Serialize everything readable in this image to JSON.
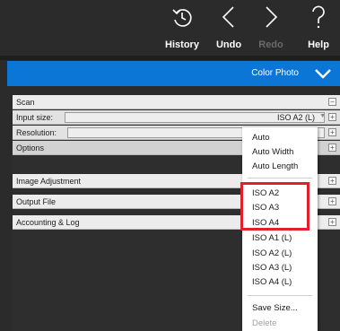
{
  "toolbar": {
    "history_label": "History",
    "undo_label": "Undo",
    "redo_label": "Redo",
    "help_label": "Help"
  },
  "banner": {
    "label": "Color Photo"
  },
  "panel": {
    "scan_label": "Scan",
    "input_size_label": "Input size:",
    "input_size_value": "ISO A2 (L)",
    "resolution_label": "Resolution:",
    "options_label": "Options",
    "image_adjustment_label": "Image Adjustment",
    "output_file_label": "Output File",
    "accounting_label": "Accounting & Log",
    "collapse_symbol": "−",
    "expand_symbol": "+"
  },
  "dropdown": {
    "options": [
      "Auto",
      "Auto Width",
      "Auto Length",
      "ISO A2",
      "ISO A3",
      "ISO A4",
      "ISO A1 (L)",
      "ISO A2 (L)",
      "ISO A3 (L)",
      "ISO A4 (L)",
      "Save Size...",
      "Delete"
    ]
  },
  "colors": {
    "accent": "#0b76d6",
    "highlight": "#e0202a",
    "toolbar_bg": "#2b2b2b"
  },
  "icons": [
    "history-icon",
    "undo-icon",
    "redo-icon",
    "help-icon",
    "chevron-down-icon"
  ]
}
